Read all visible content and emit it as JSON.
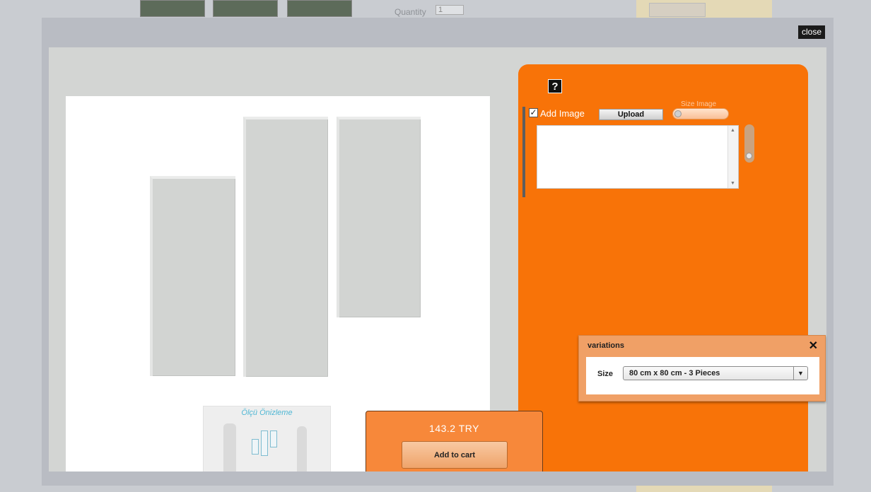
{
  "background": {
    "quantity_label": "Quantity",
    "quantity_value": "1"
  },
  "modal": {
    "close_label": "close"
  },
  "preview": {
    "size_preview_title": "Ölçü Önizleme"
  },
  "purchase": {
    "price": "143.2 TRY",
    "add_to_cart_label": "Add to cart"
  },
  "editor": {
    "help_icon": "?",
    "add_image_label": "Add Image",
    "add_image_checked": true,
    "upload_label": "Upload",
    "size_image_label": "Size Image"
  },
  "variations": {
    "title": "variations",
    "size_label": "Size",
    "size_selected": "80 cm x 80 cm - 3 Pieces"
  },
  "colors": {
    "accent": "#f87308",
    "price_box": "#f7883a",
    "overlay": "#b9bcc3"
  }
}
